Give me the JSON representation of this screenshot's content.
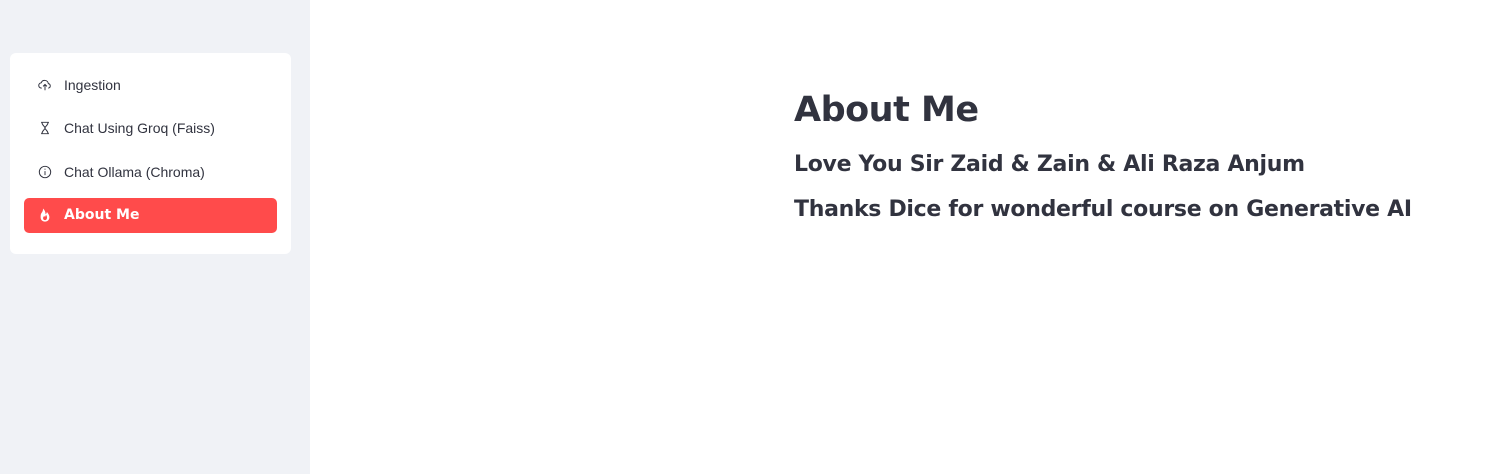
{
  "sidebar": {
    "menu": [
      {
        "label": "Ingestion",
        "icon": "cloud-upload-icon",
        "active": false
      },
      {
        "label": "Chat Using Groq (Faiss)",
        "icon": "hourglass-icon",
        "active": false
      },
      {
        "label": "Chat Ollama (Chroma)",
        "icon": "info-circle-icon",
        "active": false
      },
      {
        "label": "About Me",
        "icon": "fire-icon",
        "active": true
      }
    ]
  },
  "main": {
    "title": "About Me",
    "lines": [
      "Love You Sir Zaid & Zain & Ali Raza Anjum",
      "Thanks Dice for wonderful course on Generative AI"
    ]
  },
  "colors": {
    "accent": "#ff4b4b",
    "sidebar_bg": "#f0f2f6",
    "text": "#31333f"
  }
}
